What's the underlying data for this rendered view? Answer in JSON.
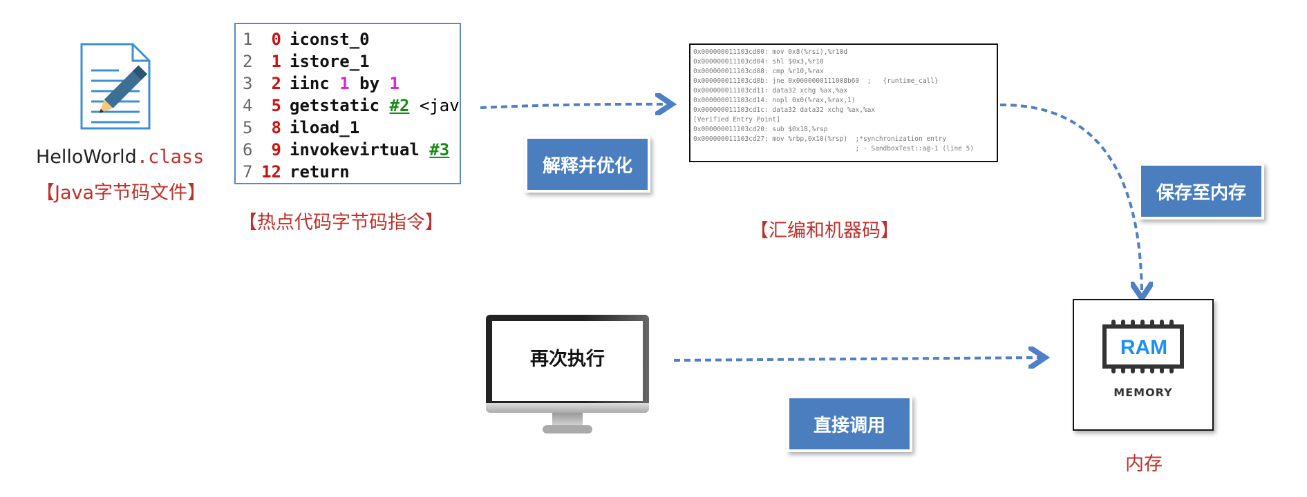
{
  "class_file": {
    "icon": "document-pencil-icon",
    "name": "HelloWorld",
    "ext": ".class",
    "label": "【Java字节码文件】"
  },
  "bytecode": {
    "lines": [
      {
        "ln": "1",
        "off": "0",
        "parts": [
          {
            "t": "iconst_0",
            "k": "ins"
          }
        ]
      },
      {
        "ln": "2",
        "off": "1",
        "parts": [
          {
            "t": "istore_1",
            "k": "ins"
          }
        ]
      },
      {
        "ln": "3",
        "off": "2",
        "parts": [
          {
            "t": "iinc ",
            "k": "ins"
          },
          {
            "t": "1",
            "k": "num"
          },
          {
            "t": " by ",
            "k": "ins"
          },
          {
            "t": "1",
            "k": "num"
          }
        ]
      },
      {
        "ln": "4",
        "off": "5",
        "parts": [
          {
            "t": "getstatic ",
            "k": "ins"
          },
          {
            "t": "#2",
            "k": "ref"
          },
          {
            "t": " <jav",
            "k": "plain"
          }
        ]
      },
      {
        "ln": "5",
        "off": "8",
        "parts": [
          {
            "t": "iload_1",
            "k": "ins"
          }
        ]
      },
      {
        "ln": "6",
        "off": "9",
        "parts": [
          {
            "t": "invokevirtual ",
            "k": "ins"
          },
          {
            "t": "#3",
            "k": "ref"
          }
        ]
      },
      {
        "ln": "7",
        "off": "12",
        "parts": [
          {
            "t": "return",
            "k": "ins"
          }
        ]
      }
    ],
    "label": "【热点代码字节码指令】"
  },
  "step1": {
    "label": "解释并优化"
  },
  "assembly": {
    "lines": [
      "0x000000011103cd00: mov 0x8(%rsi),%r10d",
      "0x000000011103cd04: shl $0x3,%r10",
      "0x000000011103cd08: cmp %r10,%rax",
      "0x000000011103cd0b: jne 0x0000000111008b60  ;   {runtime_call}",
      "0x000000011103cd11: data32 xchg %ax,%ax",
      "0x000000011103cd14: nopl 0x0(%rax,%rax,1)",
      "0x000000011103cd1c: data32 data32 xchg %ax,%ax",
      "[Verified Entry Point]",
      "0x000000011103cd20: sub $0x18,%rsp",
      "0x000000011103cd27: mov %rbp,0x10(%rsp)  ;*synchronization entry",
      "                                         ; - SandboxTest::a@-1 (line 5)"
    ],
    "label": "【汇编和机器码】"
  },
  "step2": {
    "label": "保存至内存"
  },
  "memory": {
    "icon": "ram-chip-icon",
    "chip_text": "RAM",
    "sub_text": "MEMORY",
    "label": "内存"
  },
  "monitor": {
    "icon": "monitor-icon",
    "text": "再次执行"
  },
  "step3": {
    "label": "直接调用"
  },
  "colors": {
    "accent": "#4a7ebf",
    "caption": "#c0302a",
    "arrow": "#4f7fc4"
  }
}
